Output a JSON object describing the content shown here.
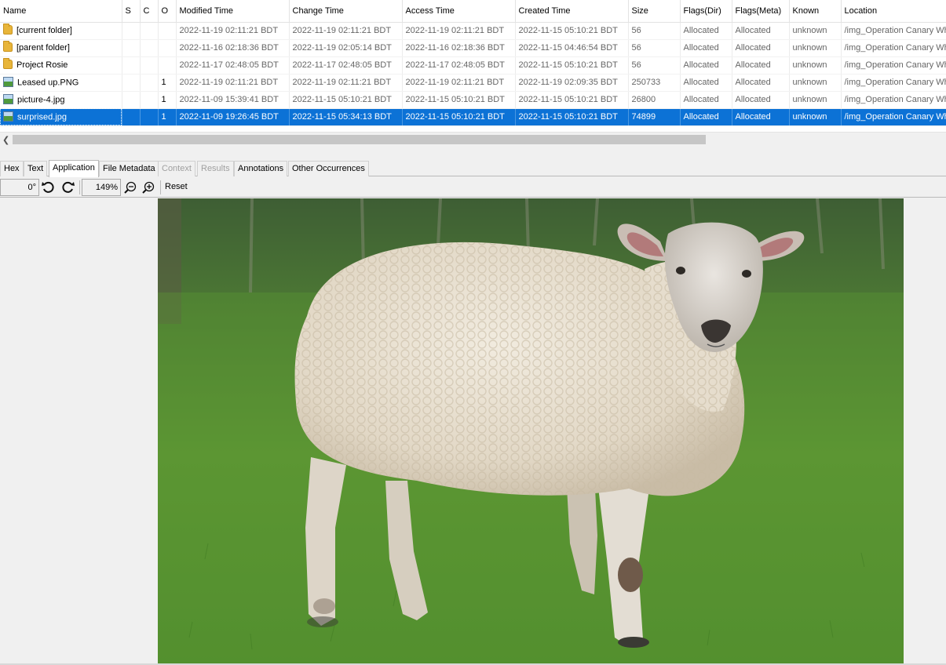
{
  "table": {
    "columns": [
      "Name",
      "S",
      "C",
      "O",
      "Modified Time",
      "Change Time",
      "Access Time",
      "Created Time",
      "Size",
      "Flags(Dir)",
      "Flags(Meta)",
      "Known",
      "Location"
    ],
    "rows": [
      {
        "icon": "folder-icon",
        "name": "[current folder]",
        "s": "",
        "c": "",
        "o": "",
        "modified": "2022-11-19 02:11:21 BDT",
        "change": "2022-11-19 02:11:21 BDT",
        "access": "2022-11-19 02:11:21 BDT",
        "created": "2022-11-15 05:10:21 BDT",
        "size": "56",
        "flags_dir": "Allocated",
        "flags_meta": "Allocated",
        "known": "unknown",
        "location": "/img_Operation Canary Wh"
      },
      {
        "icon": "folder-icon",
        "name": "[parent folder]",
        "s": "",
        "c": "",
        "o": "",
        "modified": "2022-11-16 02:18:36 BDT",
        "change": "2022-11-19 02:05:14 BDT",
        "access": "2022-11-16 02:18:36 BDT",
        "created": "2022-11-15 04:46:54 BDT",
        "size": "56",
        "flags_dir": "Allocated",
        "flags_meta": "Allocated",
        "known": "unknown",
        "location": "/img_Operation Canary Wh"
      },
      {
        "icon": "folder-icon",
        "name": "Project Rosie",
        "s": "",
        "c": "",
        "o": "",
        "modified": "2022-11-17 02:48:05 BDT",
        "change": "2022-11-17 02:48:05 BDT",
        "access": "2022-11-17 02:48:05 BDT",
        "created": "2022-11-15 05:10:21 BDT",
        "size": "56",
        "flags_dir": "Allocated",
        "flags_meta": "Allocated",
        "known": "unknown",
        "location": "/img_Operation Canary Wh"
      },
      {
        "icon": "image-file-icon",
        "name": "Leased up.PNG",
        "s": "",
        "c": "",
        "o": "1",
        "modified": "2022-11-19 02:11:21 BDT",
        "change": "2022-11-19 02:11:21 BDT",
        "access": "2022-11-19 02:11:21 BDT",
        "created": "2022-11-19 02:09:35 BDT",
        "size": "250733",
        "flags_dir": "Allocated",
        "flags_meta": "Allocated",
        "known": "unknown",
        "location": "/img_Operation Canary Wh"
      },
      {
        "icon": "image-file-icon",
        "name": "picture-4.jpg",
        "s": "",
        "c": "",
        "o": "1",
        "modified": "2022-11-09 15:39:41 BDT",
        "change": "2022-11-15 05:10:21 BDT",
        "access": "2022-11-15 05:10:21 BDT",
        "created": "2022-11-15 05:10:21 BDT",
        "size": "26800",
        "flags_dir": "Allocated",
        "flags_meta": "Allocated",
        "known": "unknown",
        "location": "/img_Operation Canary Wh"
      },
      {
        "icon": "image-file-icon",
        "name": "surprised.jpg",
        "s": "",
        "c": "",
        "o": "1",
        "modified": "2022-11-09 19:26:45 BDT",
        "change": "2022-11-15 05:34:13 BDT",
        "access": "2022-11-15 05:10:21 BDT",
        "created": "2022-11-15 05:10:21 BDT",
        "size": "74899",
        "flags_dir": "Allocated",
        "flags_meta": "Allocated",
        "known": "unknown",
        "location": "/img_Operation Canary Wh",
        "selected": true
      }
    ]
  },
  "tabs": [
    {
      "label": "Hex",
      "state": "normal"
    },
    {
      "label": "Text",
      "state": "normal"
    },
    {
      "label": "Application",
      "state": "active"
    },
    {
      "label": "File Metadata",
      "state": "normal"
    },
    {
      "label": "Context",
      "state": "disabled"
    },
    {
      "label": "Results",
      "state": "disabled"
    },
    {
      "label": "Annotations",
      "state": "normal"
    },
    {
      "label": "Other Occurrences",
      "state": "normal"
    }
  ],
  "toolbar": {
    "rotation": "0°",
    "zoom": "149%",
    "reset_label": "Reset",
    "icons": [
      "rotate-left-icon",
      "rotate-right-icon",
      "zoom-out-icon",
      "zoom-in-icon"
    ]
  },
  "viewer": {
    "image_subject": "sheep-photo"
  },
  "colors": {
    "selection": "#0c72d6",
    "folder": "#e8b53a",
    "grass": "#4f8f2e"
  }
}
